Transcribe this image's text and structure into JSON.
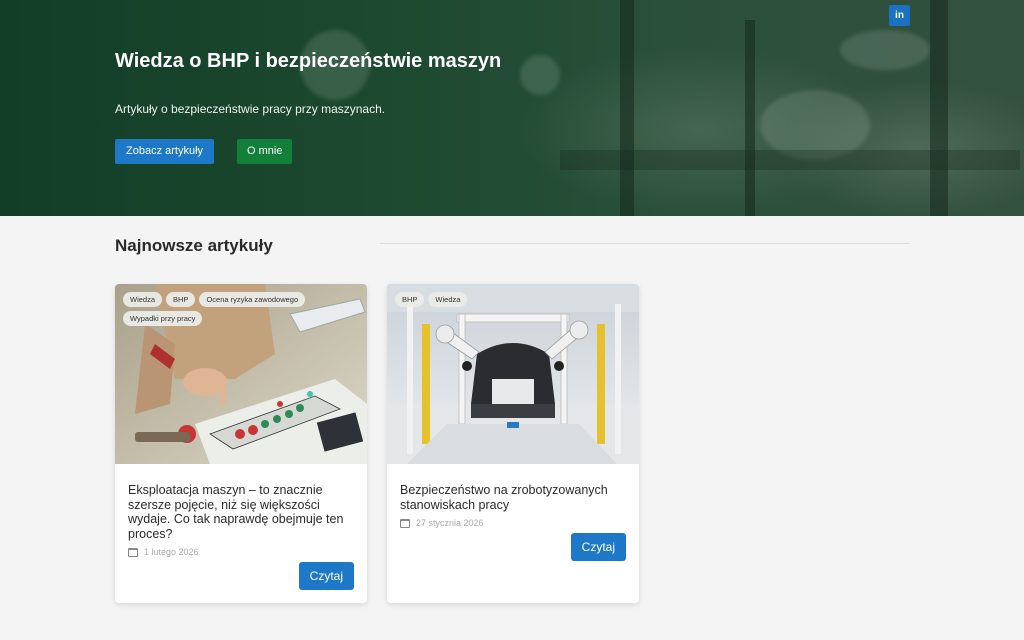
{
  "hero": {
    "title": "Wiedza o BHP i bezpieczeństwie maszyn",
    "subtitle": "Artykuły o bezpieczeństwie pracy przy maszynach.",
    "button_articles": "Zobacz artykuły",
    "button_about": "O mnie",
    "social_icon_label": "in"
  },
  "section": {
    "title": "Najnowsze artykuły"
  },
  "articles": [
    {
      "tags": [
        "Wiedza",
        "BHP",
        "Ocena ryzyka zawodowego",
        "Wypadki przy pracy"
      ],
      "title": "Eksploatacja maszyn – to znacznie szersze pojęcie, niż się większości wydaje. Co tak naprawdę obejmuje ten proces?",
      "date": "1 lutego 2026",
      "button": "Czytaj",
      "image_icon": "control-panel-photo"
    },
    {
      "tags": [
        "BHP",
        "Wiedza"
      ],
      "title": "Bezpieczeństwo na zrobotyzowanych stanowiskach pracy",
      "date": "27 stycznia 2026",
      "button": "Czytaj",
      "image_icon": "robotic-assembly-line-photo"
    }
  ],
  "colors": {
    "accent_blue": "#1e78c8",
    "accent_green": "#12803b",
    "hero_green": "#1d4a30",
    "page_background": "#f4f4f4"
  }
}
